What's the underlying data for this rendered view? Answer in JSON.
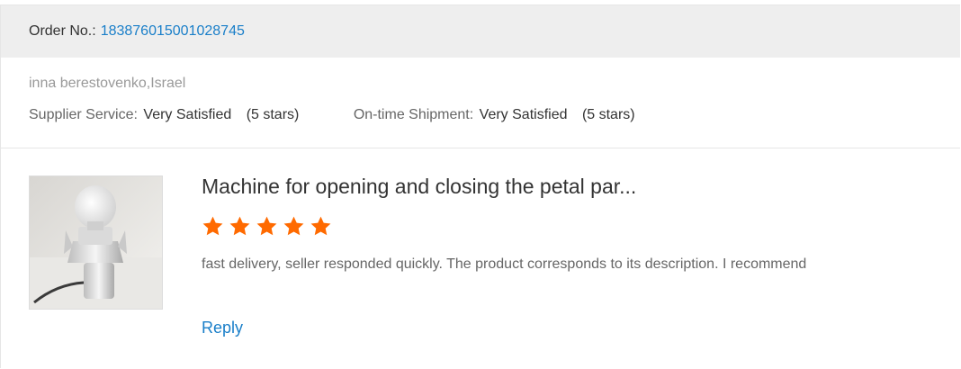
{
  "order": {
    "label": "Order No.:",
    "number": "183876015001028745"
  },
  "buyer": {
    "name": "inna berestovenko,Israel"
  },
  "ratings": {
    "supplier_service": {
      "label": "Supplier Service:",
      "value": "Very Satisfied",
      "stars_text": "(5 stars)"
    },
    "ontime_shipment": {
      "label": "On-time Shipment:",
      "value": "Very Satisfied",
      "stars_text": "(5 stars)"
    }
  },
  "review": {
    "product_title": "Machine for opening and closing the petal par...",
    "star_rating": 5,
    "star_max": 5,
    "star_color": "#ff6a00",
    "text": "fast delivery, seller responded quickly. The product corresponds to its description. I recommend",
    "product_image_icon": "product-photo",
    "reply_label": "Reply"
  },
  "colors": {
    "link": "#1a7fc9",
    "header_bg": "#eeeeee"
  }
}
